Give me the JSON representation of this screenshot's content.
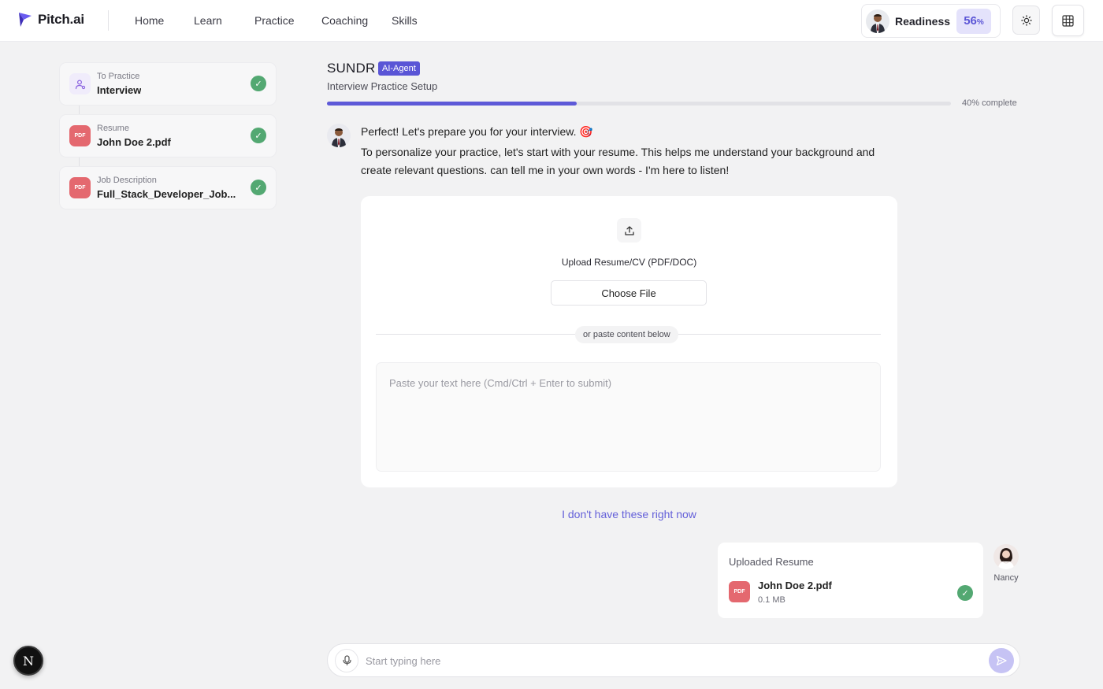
{
  "app": {
    "name": "Pitch.ai"
  },
  "nav": {
    "items": [
      {
        "label": "Home"
      },
      {
        "label": "Learn"
      },
      {
        "label": "Practice"
      },
      {
        "label": "Coaching"
      },
      {
        "label": "Skills"
      }
    ]
  },
  "readiness": {
    "label": "Readiness",
    "value": "56",
    "unit": "%"
  },
  "sidebar": {
    "steps": [
      {
        "caption": "To Practice",
        "value": "Interview",
        "icon": "person-icon",
        "status": "complete"
      },
      {
        "caption": "Resume",
        "value": "John Doe 2.pdf",
        "icon": "PDF",
        "status": "complete"
      },
      {
        "caption": "Job Description",
        "value": "Full_Stack_Developer_Job...",
        "icon": "PDF",
        "status": "complete"
      }
    ]
  },
  "header": {
    "brand": "SUNDR",
    "badge": "AI-Agent",
    "subtitle": "Interview Practice Setup",
    "progress_fraction": 0.4,
    "progress_label": "40% complete"
  },
  "assistant": {
    "message_line1": "Perfect! Let's prepare you for your interview. 🎯",
    "message_line2": "To personalize your practice, let's start with your resume. This helps me understand your background and create relevant questions. can tell me in your own words - I'm here to listen!"
  },
  "upload": {
    "label": "Upload Resume/CV (PDF/DOC)",
    "choose_button": "Choose File",
    "separator": "or paste content below",
    "paste_placeholder": "Paste your text here (Cmd/Ctrl + Enter to submit)"
  },
  "skip_link": "I don't have these right now",
  "user_message": {
    "title": "Uploaded Resume",
    "file_icon": "PDF",
    "file_name": "John Doe 2.pdf",
    "file_size": "0.1 MB",
    "user_name": "Nancy"
  },
  "composer": {
    "placeholder": "Start typing here"
  },
  "dev_badge": "N",
  "colors": {
    "accent": "#5e5ad8",
    "success": "#53a872",
    "pdf": "#e4686f",
    "page_bg": "#f2f2f3"
  }
}
